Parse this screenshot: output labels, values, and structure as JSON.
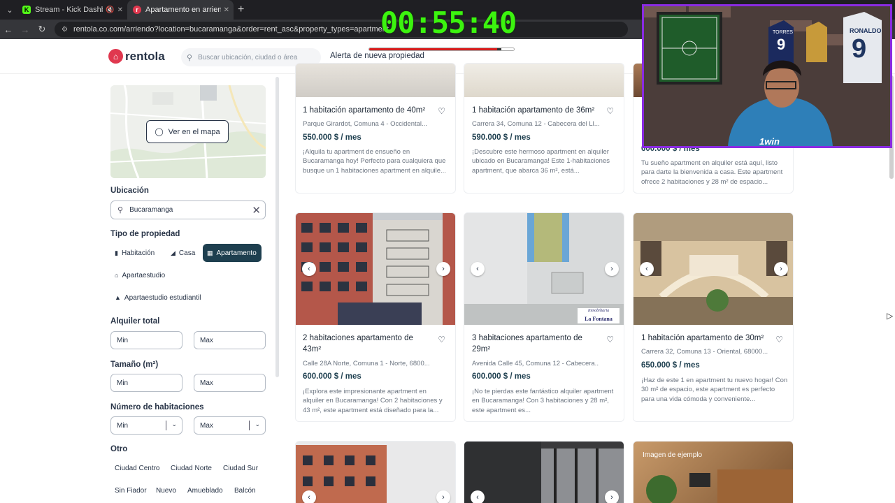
{
  "browser": {
    "tabs": [
      {
        "title": "Stream - Kick Dashboard",
        "favicon": "K"
      },
      {
        "title": "Apartamento en arriendo en Bu",
        "favicon": "r"
      }
    ],
    "new_tab_symbol": "+",
    "url": "rentola.co.com/arriendo?location=bucaramanga&order=rent_asc&property_types=apartment"
  },
  "overlay": {
    "timer": "00:55:40",
    "progress": 0.9
  },
  "header": {
    "logo_text": "rentola",
    "search_placeholder": "Buscar ubicación, ciudad o área",
    "alert_link": "Alerta de nueva propiedad"
  },
  "sidebar": {
    "map_button": "Ver en el mapa",
    "location_title": "Ubicación",
    "location_value": "Bucaramanga",
    "property_type_title": "Tipo de propiedad",
    "property_types": [
      {
        "label": "Habitación",
        "active": false
      },
      {
        "label": "Casa",
        "active": false
      },
      {
        "label": "Apartamento",
        "active": true
      },
      {
        "label": "Apartaestudio",
        "active": false
      },
      {
        "label": "Apartaestudio estudiantil",
        "active": false
      }
    ],
    "rent_title": "Alquiler total",
    "size_title": "Tamaño (m²)",
    "rooms_title": "Número de habitaciones",
    "min_label": "Min",
    "max_label": "Max",
    "other_title": "Otro",
    "other_tags": [
      "Ciudad Centro",
      "Ciudad Norte",
      "Ciudad Sur",
      "Sin Fiador",
      "Nuevo",
      "Amueblado",
      "Balcón"
    ]
  },
  "listings": [
    {
      "title": "1 habitación apartamento de 40m²",
      "address": "Parque Girardot, Comuna 4 - Occidental...",
      "price": "550.000 $ / mes",
      "description": "¡Alquila tu apartment de ensueño en Bucaramanga hoy! Perfecto para cualquiera que busque un 1 habitaciones apartment en alquile..."
    },
    {
      "title": "1 habitación apartamento de 36m²",
      "address": "Carrera 34, Comuna 12 - Cabecera del Ll...",
      "price": "590.000 $ / mes",
      "description": "¡Descubre este hermoso apartment en alquiler ubicado en Bucaramanga! Este 1-habitaciones apartment, que abarca 36 m², está..."
    },
    {
      "title": "",
      "address": "",
      "price": "600.000 $ / mes",
      "description": "Tu sueño apartment en alquiler está aquí, listo para darte la bienvenida a casa. Este apartment ofrece 2 habitaciones y 28 m² de espacio..."
    },
    {
      "title": "2 habitaciones apartamento de 43m²",
      "address": "Calle 28A Norte, Comuna 1 - Norte, 6800...",
      "price": "600.000 $ / mes",
      "description": "¡Explora este impresionante apartment en alquiler en Bucaramanga! Con 2 habitaciones y 43 m², este apartment está diseñado para la..."
    },
    {
      "title": "3 habitaciones apartamento de 29m²",
      "address": "Avenida Calle 45, Comuna 12 - Cabecera...",
      "price": "600.000 $ / mes",
      "description": "¡No te pierdas este fantástico alquiler apartment en Bucaramanga! Con 3 habitaciones y 28 m², este apartment es..."
    },
    {
      "title": "1 habitación apartamento de 30m²",
      "address": "Carrera 32, Comuna 13 - Oriental, 68000...",
      "price": "650.000 $ / mes",
      "description": "¡Haz de este 1 en apartment tu nuevo hogar! Con 30 m² de espacio, este apartment es perfecto para una vida cómoda y conveniente..."
    }
  ],
  "image_watermarks": {
    "la_fontana_top": "Inmobiliaria",
    "la_fontana": "La Fontana",
    "sample_image": "Imagen de ejemplo"
  },
  "webcam": {
    "jersey_name": "RONALDO",
    "jersey_number": "9",
    "jersey_name_2": "TORRES",
    "sponsor": "1win"
  }
}
